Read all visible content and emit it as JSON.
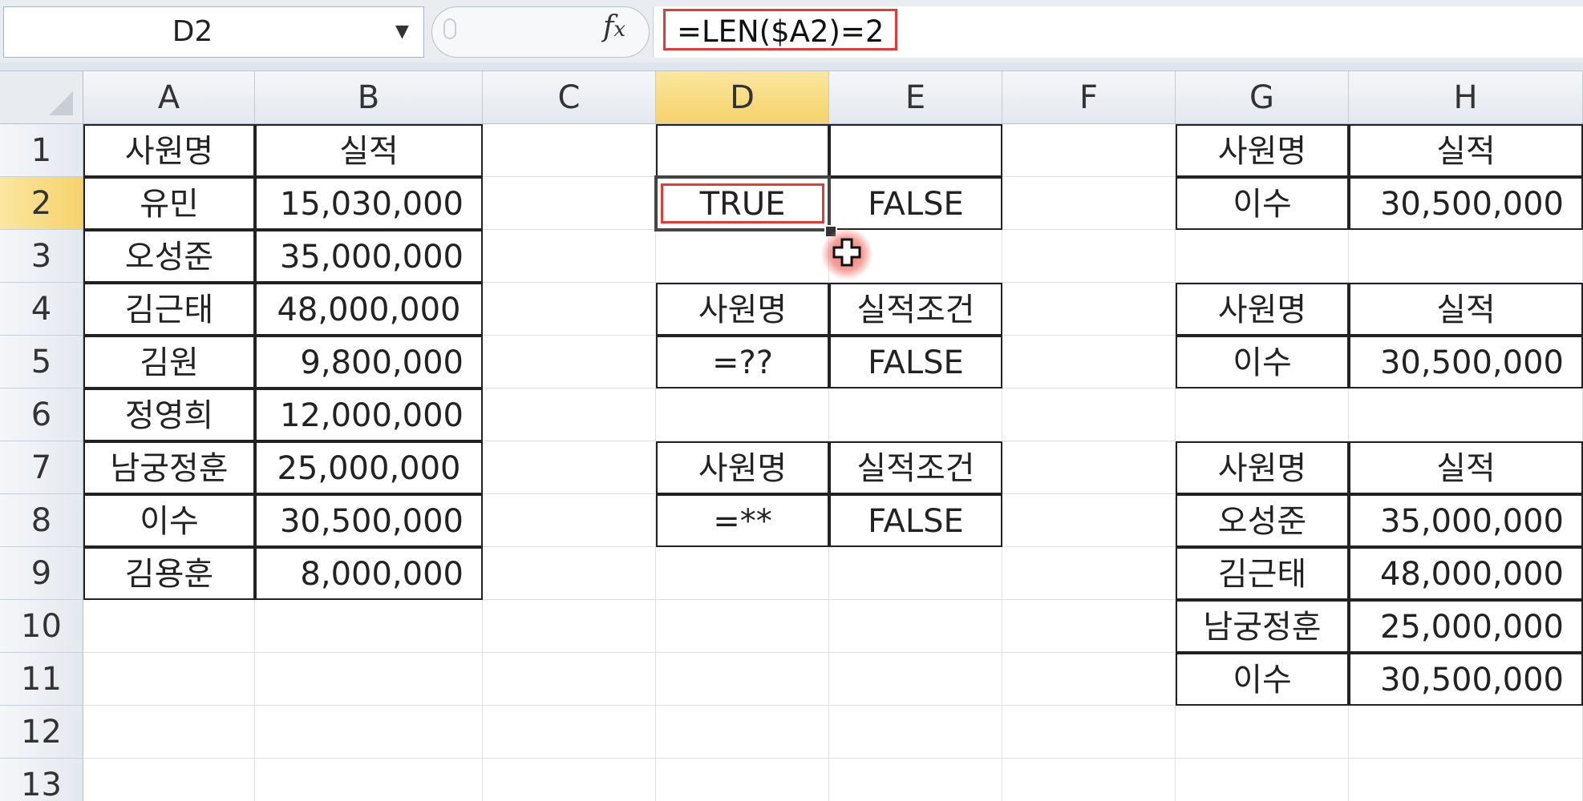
{
  "name_box": {
    "value": "D2"
  },
  "formula_bar": {
    "formula": "=LEN($A2)=2",
    "fx_label": "fx"
  },
  "columns": [
    "A",
    "B",
    "C",
    "D",
    "E",
    "F",
    "G",
    "H"
  ],
  "active_column": "D",
  "rows": [
    "1",
    "2",
    "3",
    "4",
    "5",
    "6",
    "7",
    "8",
    "9",
    "10",
    "11",
    "12",
    "13"
  ],
  "active_row": "2",
  "cells": {
    "A1": "사원명",
    "B1": "실적",
    "A2": "유민",
    "B2": "15,030,000",
    "A3": "오성준",
    "B3": "35,000,000",
    "A4": "김근태",
    "B4": "48,000,000",
    "A5": "김원",
    "B5": "9,800,000",
    "A6": "정영희",
    "B6": "12,000,000",
    "A7": "남궁정훈",
    "B7": "25,000,000",
    "A8": "이수",
    "B8": "30,500,000",
    "A9": "김용훈",
    "B9": "8,000,000",
    "D2": "TRUE",
    "E2": "FALSE",
    "D4": "사원명",
    "E4": "실적조건",
    "D5": "=??",
    "E5": "FALSE",
    "D7": "사원명",
    "E7": "실적조건",
    "D8": "=**",
    "E8": "FALSE",
    "G1": "사원명",
    "H1": "실적",
    "G2": "이수",
    "H2": "30,500,000",
    "G4": "사원명",
    "H4": "실적",
    "G5": "이수",
    "H5": "30,500,000",
    "G7": "사원명",
    "H7": "실적",
    "G8": "오성준",
    "H8": "35,000,000",
    "G9": "김근태",
    "H9": "48,000,000",
    "G10": "남궁정훈",
    "H10": "25,000,000",
    "G11": "이수",
    "H11": "30,500,000"
  },
  "colors": {
    "highlight_red": "#e53935",
    "active_header": "#f5d26b"
  }
}
